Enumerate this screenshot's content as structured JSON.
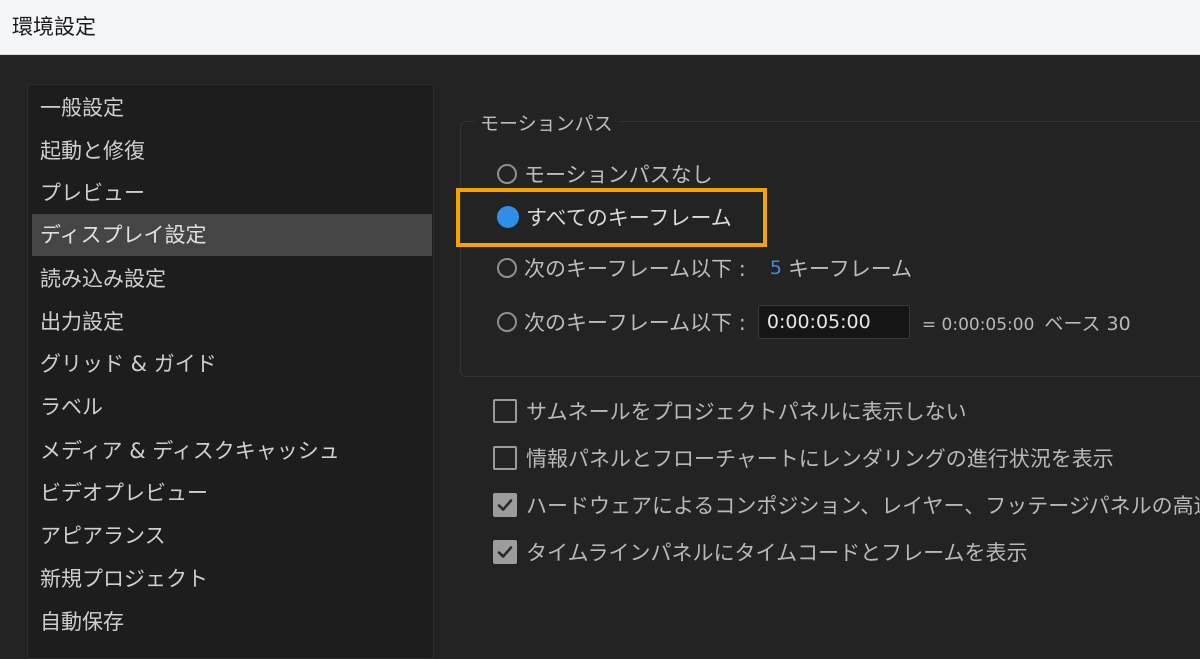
{
  "window": {
    "title": "環境設定"
  },
  "sidebar": {
    "items": [
      {
        "label": "一般設定"
      },
      {
        "label": "起動と修復"
      },
      {
        "label": "プレビュー"
      },
      {
        "label": "ディスプレイ設定",
        "selected": true
      },
      {
        "label": "読み込み設定"
      },
      {
        "label": "出力設定"
      },
      {
        "label": "グリッド & ガイド"
      },
      {
        "label": "ラベル"
      },
      {
        "label": "メディア & ディスクキャッシュ"
      },
      {
        "label": "ビデオプレビュー"
      },
      {
        "label": "アピアランス"
      },
      {
        "label": "新規プロジェクト"
      },
      {
        "label": "自動保存"
      }
    ]
  },
  "motion_path": {
    "group_title": "モーションパス",
    "options": [
      {
        "label": "モーションパスなし",
        "selected": false
      },
      {
        "label": "すべてのキーフレーム",
        "selected": true
      },
      {
        "label": "次のキーフレーム以下 :",
        "value": "5",
        "unit": "キーフレーム",
        "selected": false
      },
      {
        "label": "次のキーフレーム以下 :",
        "timecode": "0:00:05:00",
        "equals": "= 0:00:05:00",
        "base": "ベース 30",
        "selected": false
      }
    ]
  },
  "checkboxes": [
    {
      "label": "サムネールをプロジェクトパネルに表示しない",
      "checked": false
    },
    {
      "label": "情報パネルとフローチャートにレンダリングの進行状況を表示",
      "checked": false
    },
    {
      "label": "ハードウェアによるコンポジション、レイヤー、フッテージパネルの高速化",
      "checked": true
    },
    {
      "label": "タイムラインパネルにタイムコードとフレームを表示",
      "checked": true
    }
  ],
  "colors": {
    "highlight": "#f5a300",
    "radio_selected": "#2f8fe8",
    "value_accent": "#3a8fd9"
  }
}
